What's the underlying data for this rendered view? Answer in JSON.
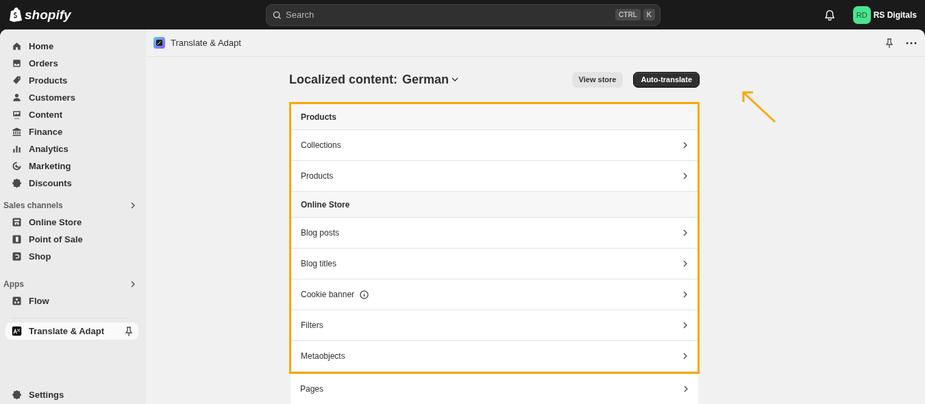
{
  "topbar": {
    "logo": "shopify",
    "search": {
      "placeholder": "Search",
      "keys": [
        "CTRL",
        "K"
      ]
    },
    "account": {
      "initials": "RD",
      "name": "RS Digitals"
    }
  },
  "sidebar": {
    "items": [
      {
        "label": "Home",
        "selected": false
      },
      {
        "label": "Orders",
        "selected": false
      },
      {
        "label": "Products",
        "selected": false
      },
      {
        "label": "Customers",
        "selected": false
      },
      {
        "label": "Content",
        "selected": false
      },
      {
        "label": "Finance",
        "selected": false
      },
      {
        "label": "Analytics",
        "selected": false
      },
      {
        "label": "Marketing",
        "selected": false
      },
      {
        "label": "Discounts",
        "selected": false
      }
    ],
    "sections": [
      {
        "title": "Sales channels",
        "items": [
          {
            "label": "Online Store",
            "selected": false
          },
          {
            "label": "Point of Sale",
            "selected": false
          },
          {
            "label": "Shop",
            "selected": false
          }
        ]
      },
      {
        "title": "Apps",
        "items": [
          {
            "label": "Flow",
            "selected": false
          }
        ]
      }
    ],
    "pinned_app": {
      "label": "Translate & Adapt",
      "selected": true
    },
    "settings": "Settings"
  },
  "app_header": {
    "title": "Translate & Adapt"
  },
  "page": {
    "title": "Localized content:",
    "language": "German",
    "buttons": [
      {
        "label": "View store",
        "kind": "secondary"
      },
      {
        "label": "Auto-translate",
        "kind": "primary"
      }
    ]
  },
  "list": [
    {
      "kind": "header",
      "label": "Products",
      "highlighted": true
    },
    {
      "kind": "row",
      "label": "Collections",
      "highlighted": true,
      "info": false
    },
    {
      "kind": "row",
      "label": "Products",
      "highlighted": true,
      "info": false
    },
    {
      "kind": "header",
      "label": "Online Store",
      "highlighted": true
    },
    {
      "kind": "row",
      "label": "Blog posts",
      "highlighted": true,
      "info": false
    },
    {
      "kind": "row",
      "label": "Blog titles",
      "highlighted": true,
      "info": false
    },
    {
      "kind": "row",
      "label": "Cookie banner",
      "highlighted": true,
      "info": true
    },
    {
      "kind": "row",
      "label": "Filters",
      "highlighted": true,
      "info": false
    },
    {
      "kind": "row",
      "label": "Metaobjects",
      "highlighted": true,
      "info": false
    },
    {
      "kind": "row",
      "label": "Pages",
      "highlighted": false,
      "info": false
    }
  ]
}
